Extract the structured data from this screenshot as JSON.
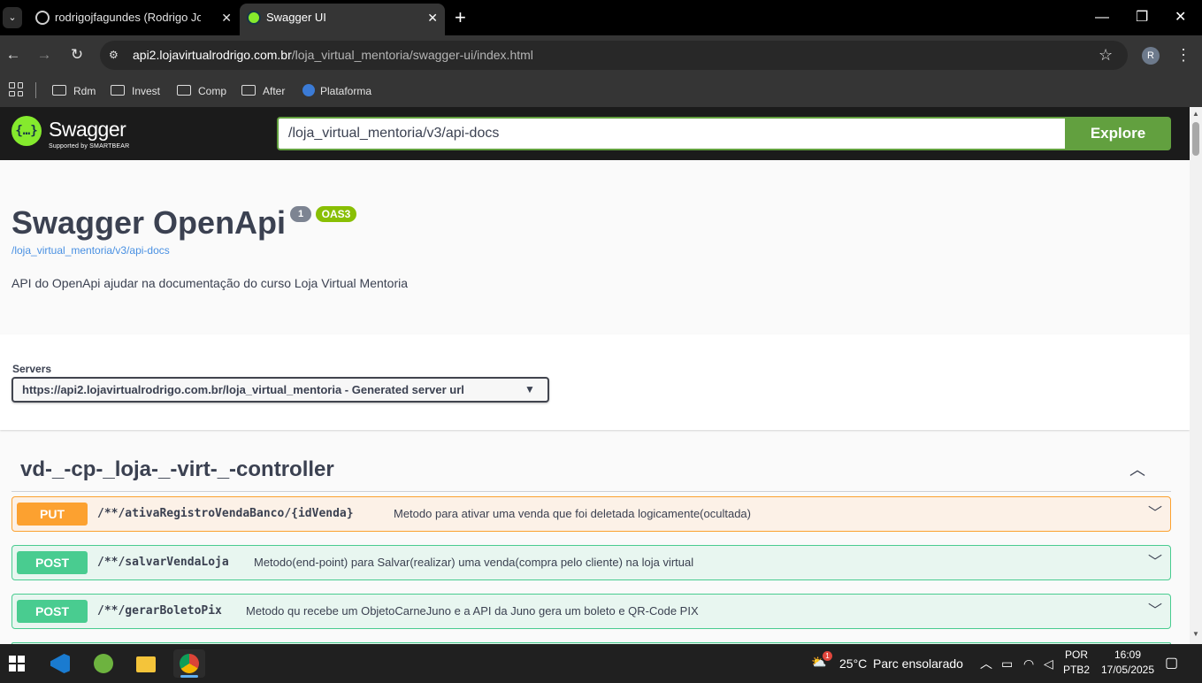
{
  "browser": {
    "tabs": [
      {
        "title": "rodrigojfagundes (Rodrigo Jose",
        "active": false
      },
      {
        "title": "Swagger UI",
        "active": true
      }
    ],
    "url_host": "api2.lojavirtualrodrigo.com.br",
    "url_path": "/loja_virtual_mentoria/swagger-ui/index.html",
    "profile_initial": "R",
    "bookmarks": [
      "Rdm",
      "Invest",
      "Comp",
      "After",
      "Plataforma"
    ]
  },
  "swagger": {
    "logo_text": "Swagger",
    "logo_sub": "Supported by SMARTBEAR",
    "explore_input": "/loja_virtual_mentoria/v3/api-docs",
    "explore_button": "Explore",
    "title": "Swagger OpenApi",
    "version_badge": "1",
    "oas_badge": "OAS3",
    "api_link": "/loja_virtual_mentoria/v3/api-docs",
    "description": "API do OpenApi ajudar na documentação do curso Loja Virtual Mentoria",
    "servers_label": "Servers",
    "server_selected": "https://api2.lojavirtualrodrigo.com.br/loja_virtual_mentoria - Generated server url",
    "tag": "vd-_-cp-_loja-_-virt-_-controller",
    "operations": [
      {
        "method": "PUT",
        "path": "/**/ativaRegistroVendaBanco/{idVenda}",
        "summary": "Metodo para ativar uma venda que foi deletada logicamente(ocultada)"
      },
      {
        "method": "POST",
        "path": "/**/salvarVendaLoja",
        "summary": "Metodo(end-point) para Salvar(realizar) uma venda(compra pelo cliente) na loja virtual"
      },
      {
        "method": "POST",
        "path": "/**/gerarBoletoPix",
        "summary": "Metodo qu recebe um ObjetoCarneJuno e a API da Juno gera um boleto e QR-Code PIX"
      }
    ]
  },
  "taskbar": {
    "weather_temp": "25°C",
    "weather_desc": "Parc ensolarado",
    "weather_badge": "1",
    "lang_top": "POR",
    "lang_bottom": "PTB2",
    "time": "16:09",
    "date": "17/05/2025"
  },
  "colors": {
    "put": "#fca130",
    "post": "#49cc90",
    "swagger_green": "#62a03f",
    "oas_green": "#89bf04"
  }
}
